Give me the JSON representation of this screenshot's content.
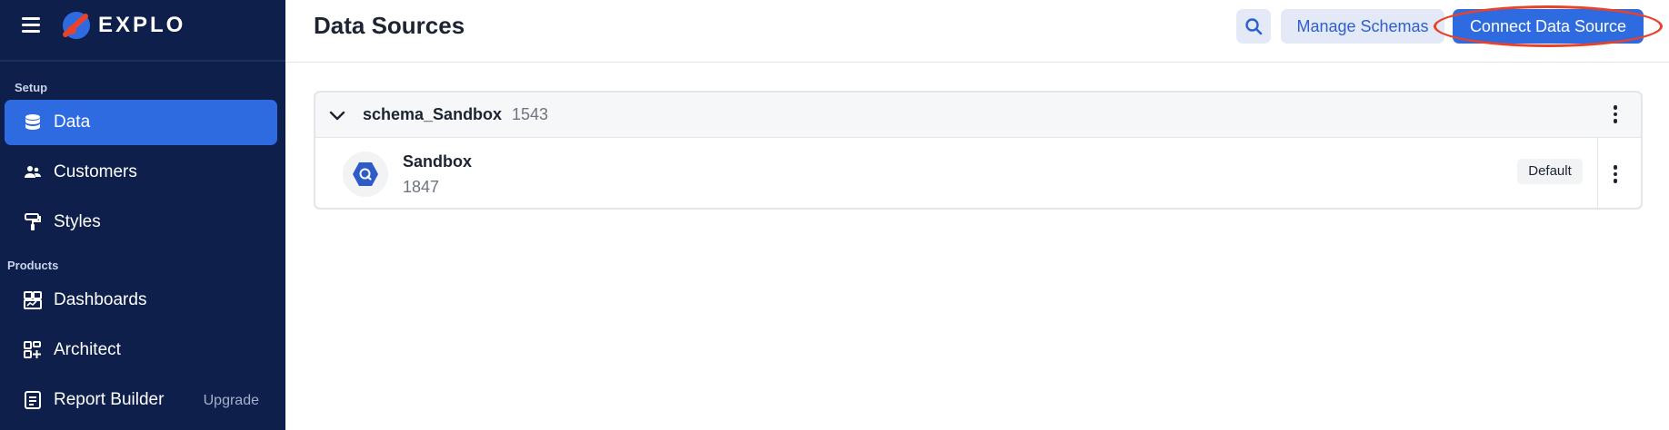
{
  "brand": {
    "name": "EXPLO"
  },
  "sidebar": {
    "sections": [
      {
        "label": "Setup"
      },
      {
        "label": "Products"
      }
    ],
    "items": [
      {
        "label": "Data",
        "icon": "database-icon",
        "active": true
      },
      {
        "label": "Customers",
        "icon": "users-icon"
      },
      {
        "label": "Styles",
        "icon": "paint-roller-icon"
      },
      {
        "label": "Dashboards",
        "icon": "dashboard-icon"
      },
      {
        "label": "Architect",
        "icon": "architect-icon"
      },
      {
        "label": "Report Builder",
        "icon": "report-icon",
        "badge": "Upgrade"
      }
    ]
  },
  "header": {
    "title": "Data Sources",
    "manage_label": "Manage Schemas",
    "connect_label": "Connect Data Source"
  },
  "schema": {
    "name": "schema_Sandbox",
    "count": "1543",
    "sources": [
      {
        "name": "Sandbox",
        "id": "1847",
        "badge": "Default",
        "icon": "bigquery-icon"
      }
    ]
  },
  "colors": {
    "sidebar_bg": "#0d1f4a",
    "accent": "#2f6be0",
    "highlight": "#e8432a"
  }
}
